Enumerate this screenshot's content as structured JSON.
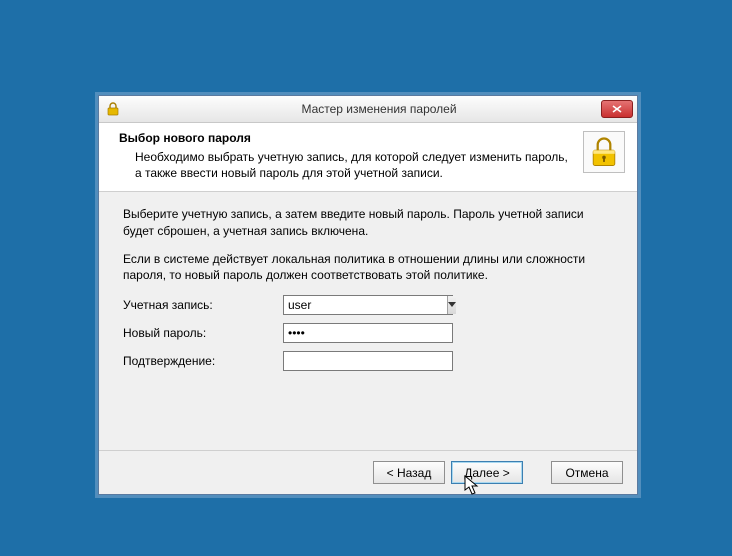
{
  "window": {
    "title": "Мастер изменения паролей"
  },
  "header": {
    "title": "Выбор нового пароля",
    "subtitle": "Необходимо выбрать учетную запись, для которой следует изменить пароль, а также ввести новый пароль для этой учетной записи."
  },
  "content": {
    "para1": "Выберите учетную запись, а затем введите новый пароль. Пароль учетной записи будет сброшен, а учетная запись включена.",
    "para2": "Если в системе действует локальная политика в отношении длины или сложности пароля, то новый пароль должен соответствовать этой политике.",
    "account_label": "Учетная запись:",
    "account_value": "user",
    "newpass_label": "Новый пароль:",
    "newpass_value": "****",
    "confirm_label": "Подтверждение:",
    "confirm_value": ""
  },
  "buttons": {
    "back": "< Назад",
    "next": "Далее >",
    "cancel": "Отмена"
  }
}
